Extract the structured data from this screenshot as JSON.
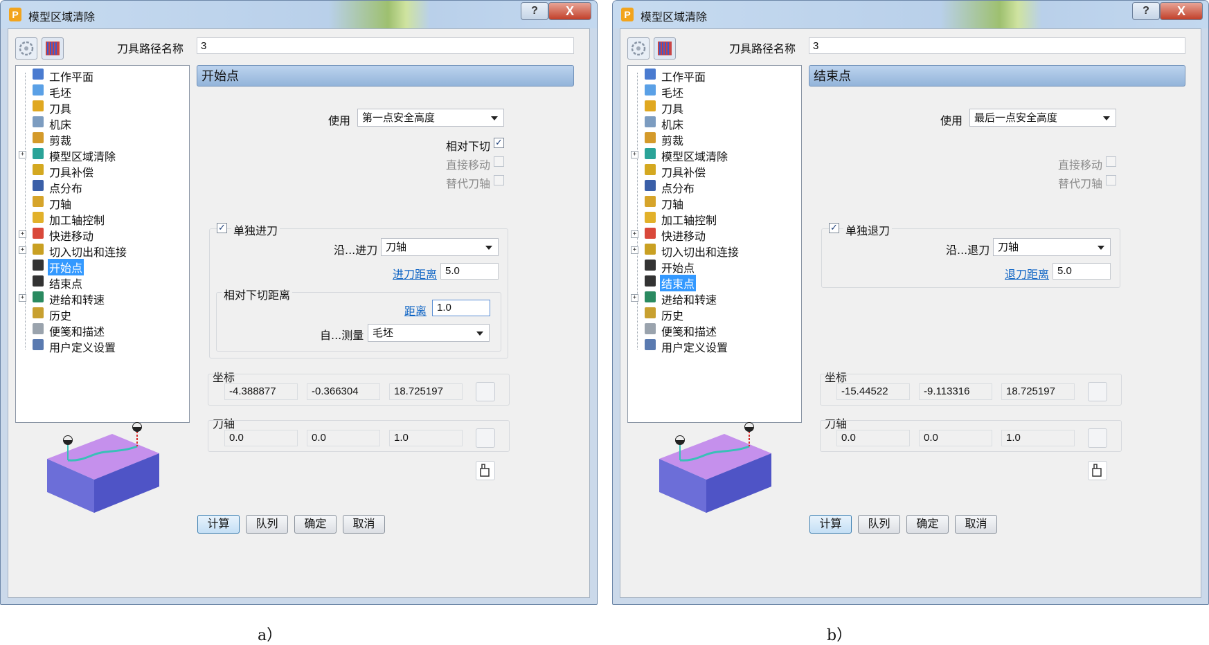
{
  "panels": {
    "a": {
      "title": "模型区域清除",
      "help_label": "?",
      "close_label": "X",
      "toolpath_name_label": "刀具路径名称",
      "toolpath_name_value": "3",
      "section_title": "开始点",
      "use_label": "使用",
      "use_value": "第一点安全高度",
      "relative_plunge_label": "相对下切",
      "relative_plunge_checked": true,
      "direct_move_label": "直接移动",
      "alt_axis_label": "替代刀轴",
      "separate_label": "单独进刀",
      "along_label": "沿...进刀",
      "along_value": "刀轴",
      "dist_label": "进刀距离",
      "dist_value": "5.0",
      "relative_group_label": "相对下切距离",
      "distance_label": "距离",
      "distance_value": "1.0",
      "measure_label": "自...测量",
      "measure_value": "毛坯",
      "coord_label": "坐标",
      "coords": [
        "-4.388877",
        "-0.366304",
        "18.725197"
      ],
      "axis_label": "刀轴",
      "axis": [
        "0.0",
        "0.0",
        "1.0"
      ],
      "caption": "a）"
    },
    "b": {
      "title": "模型区域清除",
      "help_label": "?",
      "close_label": "X",
      "toolpath_name_label": "刀具路径名称",
      "toolpath_name_value": "3",
      "section_title": "结束点",
      "use_label": "使用",
      "use_value": "最后一点安全高度",
      "direct_move_label": "直接移动",
      "alt_axis_label": "替代刀轴",
      "separate_label": "单独退刀",
      "along_label": "沿...退刀",
      "along_value": "刀轴",
      "dist_label": "退刀距离",
      "dist_value": "5.0",
      "coord_label": "坐标",
      "coords": [
        "-15.44522",
        "-9.113316",
        "18.725197"
      ],
      "axis_label": "刀轴",
      "axis": [
        "0.0",
        "0.0",
        "1.0"
      ],
      "caption": "b）"
    }
  },
  "tree_items": [
    {
      "label": "工作平面",
      "icon": "workplane-icon",
      "color": "#4a7bd0",
      "expandable": false
    },
    {
      "label": "毛坯",
      "icon": "block-icon",
      "color": "#5aa0e6",
      "expandable": false
    },
    {
      "label": "刀具",
      "icon": "tool-icon",
      "color": "#e0a820",
      "expandable": false
    },
    {
      "label": "机床",
      "icon": "machine-icon",
      "color": "#7c9cc0",
      "expandable": false
    },
    {
      "label": "剪裁",
      "icon": "limit-icon",
      "color": "#d49a2a",
      "expandable": false
    },
    {
      "label": "模型区域清除",
      "icon": "area-clear-icon",
      "color": "#2aa398",
      "expandable": true
    },
    {
      "label": "刀具补偿",
      "icon": "tool-comp-icon",
      "color": "#d4a820",
      "expandable": false
    },
    {
      "label": "点分布",
      "icon": "point-dist-icon",
      "color": "#3a5fa8",
      "expandable": false
    },
    {
      "label": "刀轴",
      "icon": "tool-axis-icon",
      "color": "#d6a42a",
      "expandable": false
    },
    {
      "label": "加工轴控制",
      "icon": "axis-control-icon",
      "color": "#e2b12a",
      "expandable": false
    },
    {
      "label": "快进移动",
      "icon": "rapid-move-icon",
      "color": "#d9483a",
      "expandable": true
    },
    {
      "label": "切入切出和连接",
      "icon": "leads-links-icon",
      "color": "#c9a022",
      "expandable": true
    },
    {
      "label": "开始点",
      "icon": "start-point-icon",
      "color": "#333333",
      "expandable": false
    },
    {
      "label": "结束点",
      "icon": "end-point-icon",
      "color": "#333333",
      "expandable": false
    },
    {
      "label": "进给和转速",
      "icon": "feeds-speeds-icon",
      "color": "#2a8a60",
      "expandable": true
    },
    {
      "label": "历史",
      "icon": "history-icon",
      "color": "#c8a030",
      "expandable": false
    },
    {
      "label": "便笺和描述",
      "icon": "notes-icon",
      "color": "#9aa3ad",
      "expandable": false
    },
    {
      "label": "用户定义设置",
      "icon": "user-settings-icon",
      "color": "#5a7ab0",
      "expandable": false
    }
  ],
  "buttons": {
    "calc": "计算",
    "queue": "队列",
    "ok": "确定",
    "cancel": "取消"
  }
}
